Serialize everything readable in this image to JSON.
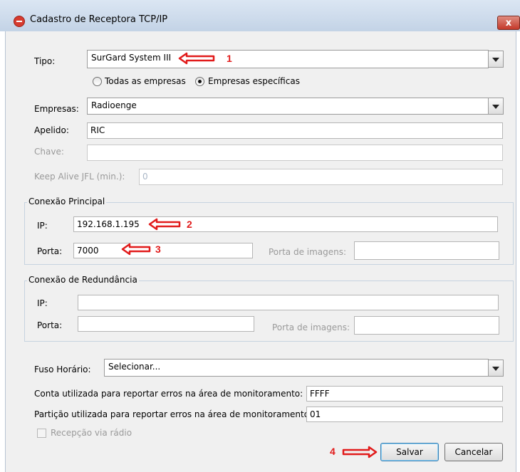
{
  "window": {
    "title": "Cadastro de Receptora TCP/IP",
    "close_label": "x"
  },
  "tipo": {
    "label": "Tipo:",
    "value": "SurGard System III"
  },
  "company_scope": {
    "option_all": "Todas as empresas",
    "option_specific": "Empresas específicas",
    "selected": "Empresas específicas"
  },
  "empresas": {
    "label": "Empresas:",
    "value": "Radioenge"
  },
  "apelido": {
    "label": "Apelido:",
    "value": "RIC"
  },
  "chave": {
    "label": "Chave:",
    "value": ""
  },
  "keep_alive": {
    "label": "Keep Alive JFL (min.):",
    "value": "0"
  },
  "principal": {
    "title": "Conexão Principal",
    "ip_label": "IP:",
    "ip_value": "192.168.1.195",
    "porta_label": "Porta:",
    "porta_value": "7000",
    "porta_imagens_label": "Porta de imagens:",
    "porta_imagens_value": ""
  },
  "redundancia": {
    "title": "Conexão de Redundância",
    "ip_label": "IP:",
    "ip_value": "",
    "porta_label": "Porta:",
    "porta_value": "",
    "porta_imagens_label": "Porta de imagens:",
    "porta_imagens_value": ""
  },
  "fuso": {
    "label": "Fuso Horário:",
    "value": "Selecionar..."
  },
  "conta": {
    "label": "Conta utilizada para reportar erros na área de monitoramento:",
    "value": "FFFF"
  },
  "particao": {
    "label": "Partição utilizada para reportar erros na área de monitoramento:",
    "value": "01"
  },
  "recepcao": {
    "label": "Recepção via rádio",
    "checked": false
  },
  "buttons": {
    "save": "Salvar",
    "cancel": "Cancelar"
  },
  "annotations": [
    "1",
    "2",
    "3",
    "4"
  ],
  "colors": {
    "annotation": "#e11b1b",
    "title_bar": "#c3d3e6"
  }
}
